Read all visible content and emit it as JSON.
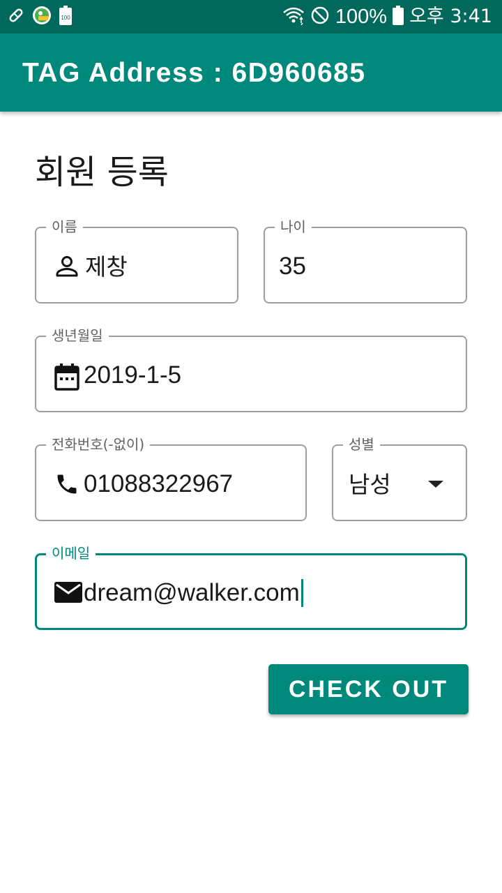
{
  "status_bar": {
    "battery_percent": "100%",
    "time": "오후 3:41",
    "left_icons": [
      "edit-icon",
      "app-badge-icon",
      "battery-100-icon"
    ],
    "right_icons": [
      "wifi-icon",
      "do-not-disturb-icon",
      "battery-icon"
    ]
  },
  "app_bar": {
    "title": "TAG Address : 6D960685"
  },
  "form": {
    "title": "회원 등록",
    "name": {
      "label": "이름",
      "value": "제창",
      "icon": "person-icon"
    },
    "age": {
      "label": "나이",
      "value": "35"
    },
    "birthdate": {
      "label": "생년월일",
      "value": "2019-1-5",
      "icon": "calendar-icon"
    },
    "phone": {
      "label": "전화번호(-없이)",
      "value": "01088322967",
      "icon": "phone-icon"
    },
    "gender": {
      "label": "성별",
      "value": "남성",
      "icon": "dropdown-arrow-icon"
    },
    "email": {
      "label": "이메일",
      "value": "dream@walker.com",
      "icon": "email-icon",
      "focused": true
    }
  },
  "actions": {
    "checkout_label": "CHECK OUT"
  },
  "colors": {
    "status_bar": "#00695c",
    "app_bar": "#00897b",
    "accent": "#00897b",
    "field_border": "#9e9e9e"
  }
}
